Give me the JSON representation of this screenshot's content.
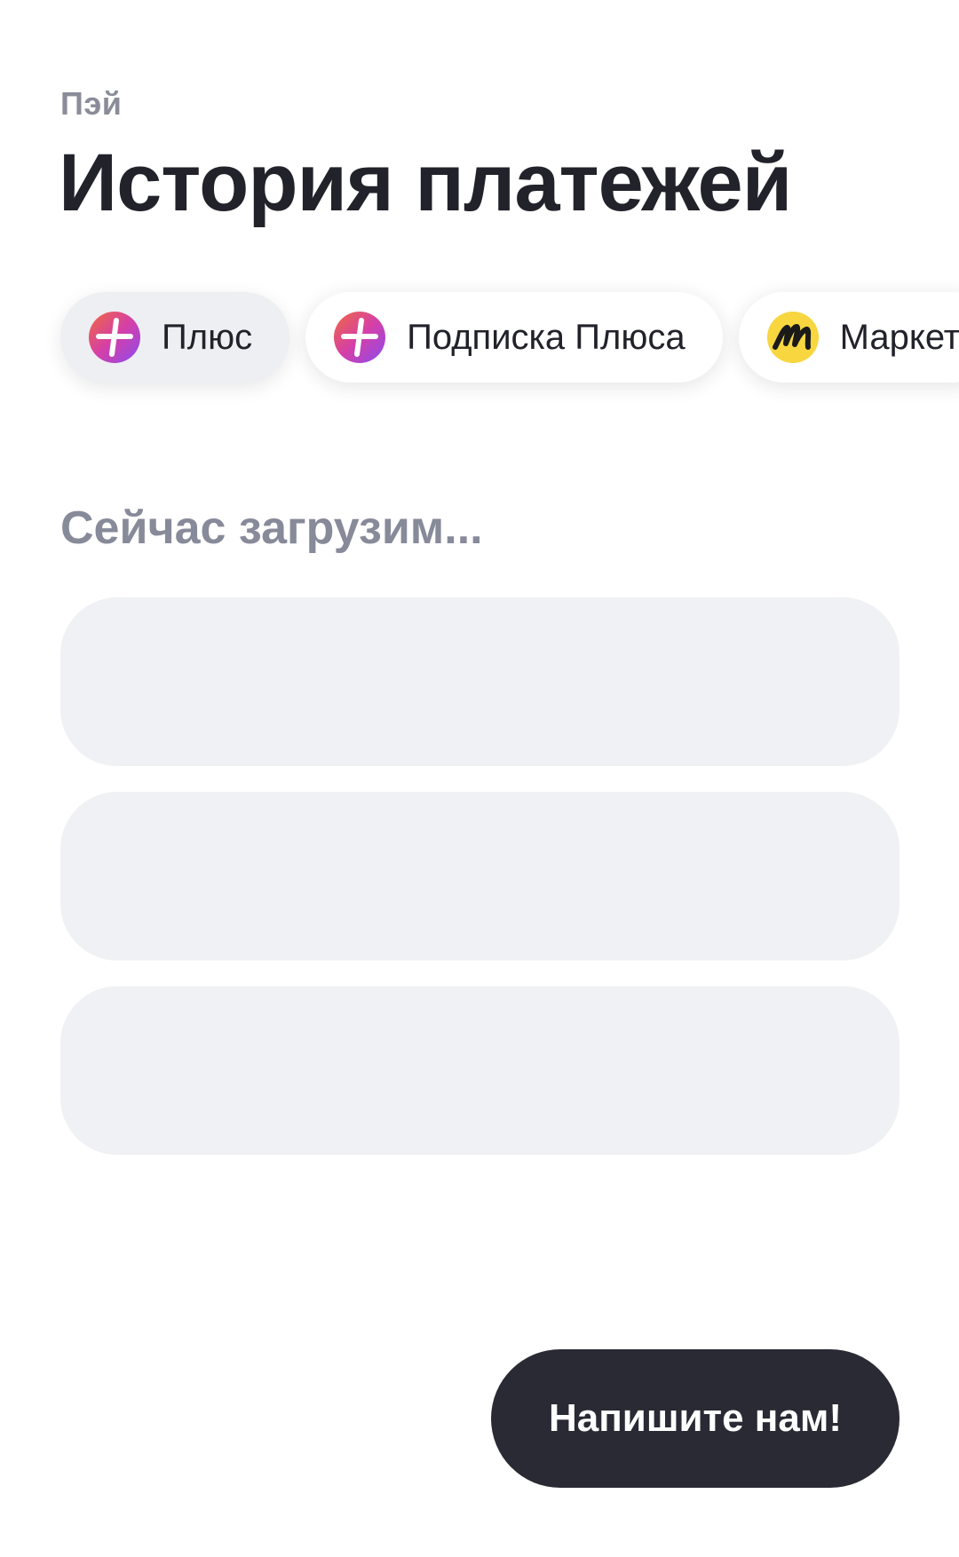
{
  "header": {
    "eyebrow": "Пэй",
    "title": "История платежей"
  },
  "filters": [
    {
      "label": "Плюс",
      "icon": "plus-icon",
      "active": true
    },
    {
      "label": "Подписка Плюса",
      "icon": "plus-icon",
      "active": false
    },
    {
      "label": "Маркет",
      "icon": "market-icon",
      "active": false
    }
  ],
  "status": {
    "loading_text": "Сейчас загрузим..."
  },
  "actions": {
    "write_us": "Напишите нам!"
  },
  "colors": {
    "title": "#21222a",
    "muted": "#878a99",
    "skeleton": "#f0f1f4",
    "button_bg": "#292a33",
    "plus_gradient": [
      "#f06a3e",
      "#d53fa7",
      "#8b4bf0"
    ],
    "market_yellow": "#f7d640"
  }
}
